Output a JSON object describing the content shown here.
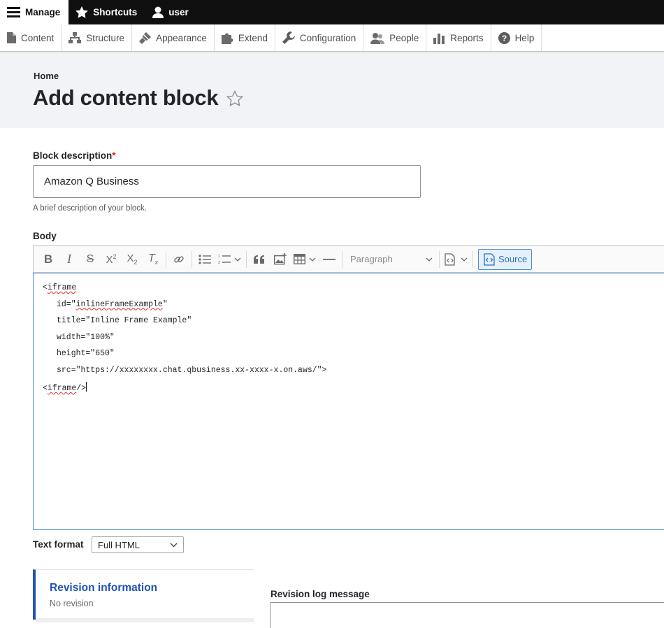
{
  "toolbar": {
    "manage_label": "Manage",
    "shortcuts_label": "Shortcuts",
    "user_label": "user"
  },
  "tray": {
    "items": [
      {
        "label": "Content",
        "icon": "file-icon"
      },
      {
        "label": "Structure",
        "icon": "sitemap-icon"
      },
      {
        "label": "Appearance",
        "icon": "paintbrush-icon"
      },
      {
        "label": "Extend",
        "icon": "puzzle-icon"
      },
      {
        "label": "Configuration",
        "icon": "wrench-icon"
      },
      {
        "label": "People",
        "icon": "people-icon"
      },
      {
        "label": "Reports",
        "icon": "bar-chart-icon"
      },
      {
        "label": "Help",
        "icon": "help-icon"
      }
    ]
  },
  "header": {
    "breadcrumb": "Home",
    "title": "Add content block",
    "star": "☆"
  },
  "form": {
    "block_description_label": "Block description",
    "required_marker": "*",
    "block_description_value": "Amazon Q Business",
    "block_description_hint": "A brief description of your block.",
    "body_label": "Body",
    "text_format_label": "Text format",
    "text_format_value": "Full HTML"
  },
  "editor": {
    "paragraph_label": "Paragraph",
    "source_label": "Source",
    "lines": {
      "l1_open": "<",
      "l1_tag": "iframe",
      "l2_attr": "id=\"",
      "l2_val": "inlineFrameExample",
      "l2_end": "\"",
      "l3": "title=\"Inline Frame Example\"",
      "l4": "width=\"100%\"",
      "l5": "height=\"650\"",
      "l6": "src=\"https://xxxxxxxx.chat.qbusiness.xx-xxxx-x.on.aws/\">",
      "l7_open": "<",
      "l7_tag": "iframe",
      "l7_end": "/>"
    }
  },
  "revision": {
    "title": "Revision information",
    "subtitle": "No revision",
    "log_label": "Revision log message"
  }
}
